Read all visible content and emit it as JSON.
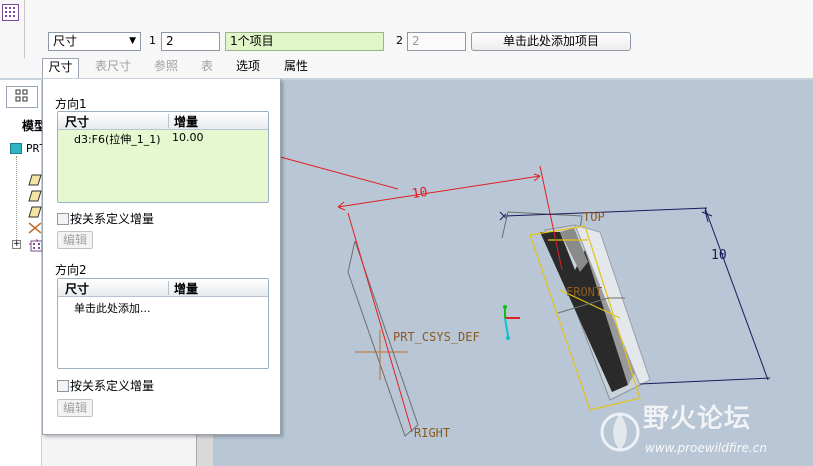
{
  "dashboard": {
    "dim_type_value": "尺寸",
    "dir1_label": "1",
    "dir1_count": "2",
    "dir1_items": "1个项目",
    "dir2_label": "2",
    "dir2_count": "2",
    "add_item_label": "单击此处添加项目"
  },
  "tabs": [
    {
      "label": "尺寸",
      "active": true
    },
    {
      "label": "表尺寸",
      "enabled": false
    },
    {
      "label": "参照",
      "enabled": false
    },
    {
      "label": "表",
      "enabled": false
    },
    {
      "label": "选项",
      "enabled": true
    },
    {
      "label": "属性",
      "enabled": true
    }
  ],
  "model_tree": {
    "header": "模型",
    "root_label": "PRT"
  },
  "dim_panel": {
    "direction1": {
      "title": "方向1",
      "col_dimension": "尺寸",
      "col_increment": "增量",
      "rows": [
        {
          "dimension": "d3:F6(拉伸_1_1)",
          "increment": "10.00"
        }
      ],
      "checkbox_label": "按关系定义增量",
      "edit_label": "编辑"
    },
    "direction2": {
      "title": "方向2",
      "col_dimension": "尺寸",
      "col_increment": "增量",
      "placeholder_row": "单击此处添加...",
      "checkbox_label": "按关系定义增量",
      "edit_label": "编辑"
    }
  },
  "graphics": {
    "dim_pattern": "10",
    "dim_width": "10",
    "dim_height": "10",
    "datum_top": "TOP",
    "datum_front": "FRONT",
    "datum_right": "RIGHT",
    "csys_label": "PRT_CSYS_DEF"
  },
  "watermark": {
    "title": "野火论坛",
    "url": "www.proewildfire.cn"
  },
  "colors": {
    "graphics_bg": "#b8c6d6",
    "dimension_red": "#e02020",
    "selection_yellow": "#e5c21a",
    "items_green": "#e1f6c8"
  }
}
